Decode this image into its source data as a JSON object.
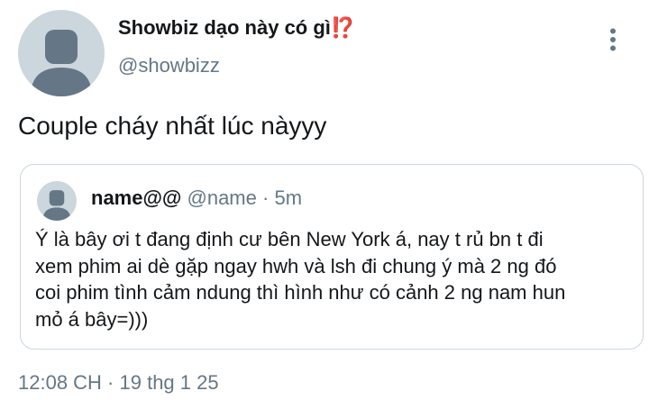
{
  "tweet": {
    "author_name": "Showbiz dạo này có gì",
    "author_emoji": "⁉️",
    "author_handle": "@showbizz",
    "text": "Couple cháy nhất lúc nàyyy",
    "more_icon": "more-vertical-icon",
    "timestamp": "12:08 CH · 19 thg 1 25"
  },
  "quote": {
    "name": "name@@",
    "handle": "@name",
    "separator": "·",
    "time": "5m",
    "lines": [
      "Ý là bây ơi t đang định cư bên New York á, nay t rủ bn t đi",
      "xem phim ai dè gặp ngay hwh và lsh đi chung ý mà 2 ng đó",
      "coi phim tình cảm ndung thì hình như có  cảnh 2 ng nam hun",
      "mỏ á bây=)))"
    ]
  },
  "colors": {
    "text_primary": "#14171a",
    "text_secondary": "#657786",
    "border": "#ccd6dd",
    "avatar_bg": "#ccd6dd",
    "avatar_fg": "#657786",
    "emoji_red": "#d9263c"
  }
}
